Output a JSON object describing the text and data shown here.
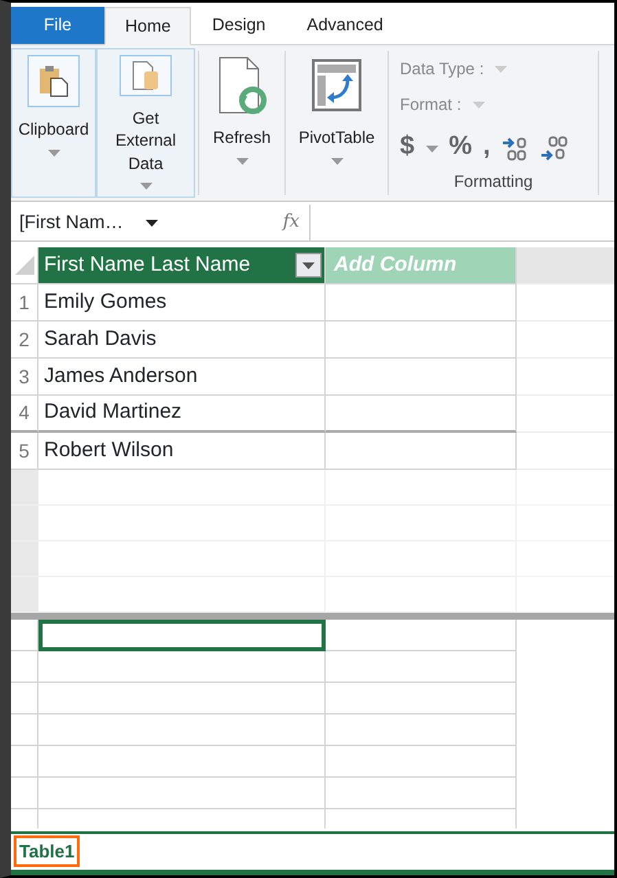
{
  "tabs": [
    {
      "label": "File",
      "kind": "file",
      "selected": false
    },
    {
      "label": "Home",
      "kind": "tab",
      "selected": true
    },
    {
      "label": "Design",
      "kind": "tab",
      "selected": false
    },
    {
      "label": "Advanced",
      "kind": "tab",
      "selected": false
    }
  ],
  "ribbon": {
    "buttons": [
      {
        "label": "Clipboard",
        "kind": "clipboard",
        "highlighted": true
      },
      {
        "label": "Get External Data",
        "kind": "external",
        "highlighted": true
      },
      {
        "label": "Refresh",
        "kind": "refresh",
        "highlighted": false
      },
      {
        "label": "PivotTable",
        "kind": "pivot",
        "highlighted": false
      }
    ],
    "formatting": {
      "data_type": "Data Type :",
      "format": "Format :",
      "symbols": [
        "$",
        "%",
        ","
      ],
      "label": "Formatting"
    }
  },
  "formula_bar": {
    "name_box": "[First  Nam…",
    "fx": "fx"
  },
  "table": {
    "columns": [
      {
        "label": "First Name Last Name",
        "kind": "data"
      },
      {
        "label": "Add Column",
        "kind": "add"
      }
    ],
    "rows": [
      {
        "number": "1",
        "value": "Emily Gomes"
      },
      {
        "number": "2",
        "value": "Sarah Davis"
      },
      {
        "number": "3",
        "value": "James Anderson"
      },
      {
        "number": "4",
        "value": "David Martinez"
      },
      {
        "number": "5",
        "value": "Robert Wilson"
      }
    ]
  },
  "sheet_tabs": [
    {
      "label": "Table1",
      "selected": true
    }
  ]
}
